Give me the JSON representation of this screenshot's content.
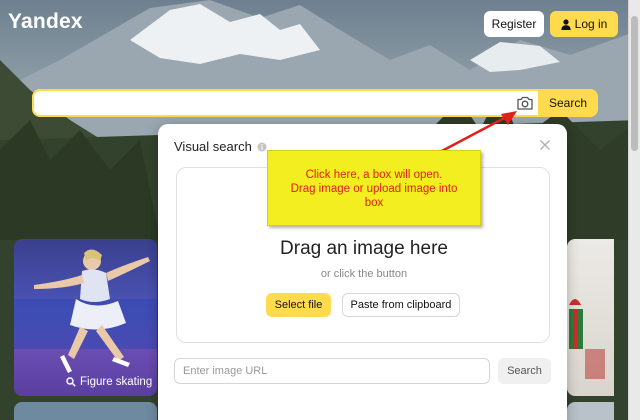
{
  "header": {
    "logo": "Yandex",
    "register_label": "Register",
    "login_label": "Log in"
  },
  "search": {
    "value": "",
    "button_label": "Search"
  },
  "visual_search": {
    "title": "Visual search",
    "drop_title": "Drag an image here",
    "drop_subtitle": "or click the button",
    "select_file_label": "Select file",
    "paste_label": "Paste from clipboard",
    "url_placeholder": "Enter image URL",
    "url_search_label": "Search"
  },
  "cards": {
    "left_caption": "Figure skating"
  },
  "annotation": {
    "line1": "Click here, a box will open.",
    "line2": "Drag image or upload image into",
    "line3": "box"
  },
  "colors": {
    "accent": "#ffdb4d",
    "note_bg": "#f2ee1f",
    "note_text": "#e0201a",
    "arrow": "#e0201a"
  }
}
